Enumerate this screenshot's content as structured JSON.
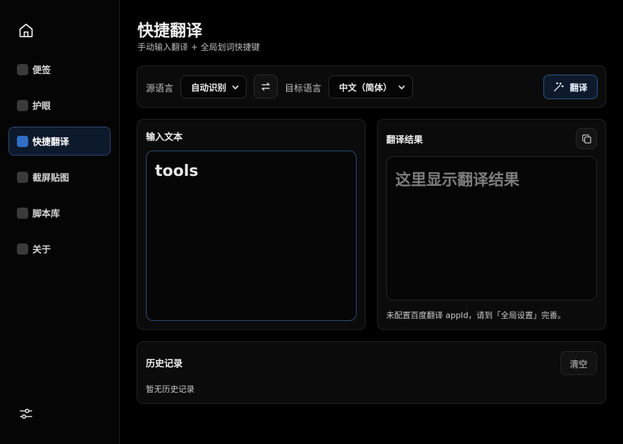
{
  "sidebar": {
    "items": [
      {
        "label": "便签",
        "active": false
      },
      {
        "label": "护眼",
        "active": false
      },
      {
        "label": "快捷翻译",
        "active": true
      },
      {
        "label": "截屏贴图",
        "active": false
      },
      {
        "label": "脚本库",
        "active": false
      },
      {
        "label": "关于",
        "active": false
      }
    ]
  },
  "header": {
    "title": "快捷翻译",
    "subtitle": "手动输入翻译 + 全局划词快捷键"
  },
  "toolbar": {
    "source_label": "源语言",
    "source_value": "自动识别",
    "target_label": "目标语言",
    "target_value": "中文（简体）",
    "translate_label": "翻译"
  },
  "input": {
    "title": "输入文本",
    "value": "tools"
  },
  "output": {
    "title": "翻译结果",
    "placeholder": "这里显示翻译结果",
    "hint": "未配置百度翻译 appId，请到「全局设置」完善。"
  },
  "history": {
    "title": "历史记录",
    "clear_label": "清空",
    "empty_text": "暂无历史记录"
  },
  "colors": {
    "accent": "#2f6fc6",
    "background": "#000000",
    "panel": "#0b0b0b"
  }
}
